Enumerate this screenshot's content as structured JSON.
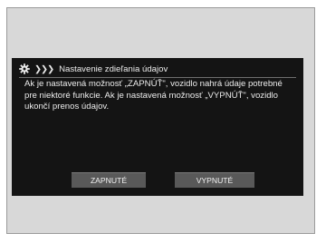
{
  "dialog": {
    "title": "Nastavenie zdieľania údajov",
    "message": "Ak je nastavená možnosť „ZAPNÚŤ\", vozidlo nahrá údaje potrebné pre niektoré funkcie. Ak je nastavená možnosť „VYPNÚŤ\", vozidlo ukončí prenos údajov.",
    "buttons": {
      "on_label": "ZAPNUTÉ",
      "off_label": "VYPNUTÉ"
    }
  },
  "icons": {
    "settings": "gear-icon",
    "breadcrumb": "triple-chevron-icon"
  },
  "colors": {
    "screen_bg": "#141414",
    "bezel_bg": "#d8d8d8",
    "button_bg": "#595959",
    "text": "#ececec"
  }
}
